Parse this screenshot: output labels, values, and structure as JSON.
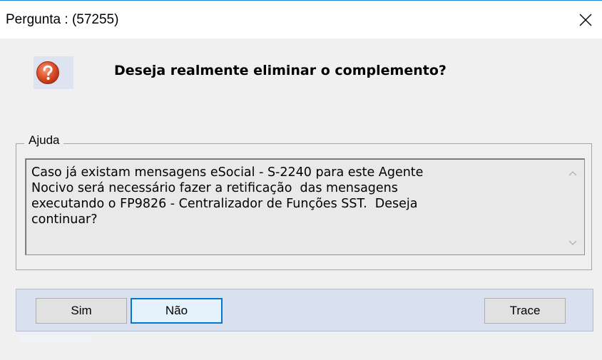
{
  "window": {
    "title": "Pergunta : (57255)"
  },
  "dialog": {
    "icon": "question-icon",
    "question": "Deseja realmente eliminar o complemento?"
  },
  "help": {
    "legend": "Ajuda",
    "text": "Caso já existam mensagens eSocial - S-2240 para este Agente\nNocivo será necessário fazer a retificação  das mensagens\nexecutando o FP9826 - Centralizador de Funções SST.  Deseja\ncontinuar?"
  },
  "buttons": {
    "sim": "Sim",
    "nao": "Não",
    "trace": "Trace"
  },
  "colors": {
    "title_border": "#1883d7",
    "button_bar": "#d9e1f1",
    "focus_border": "#0078d7",
    "question_icon": "#d9451f"
  }
}
